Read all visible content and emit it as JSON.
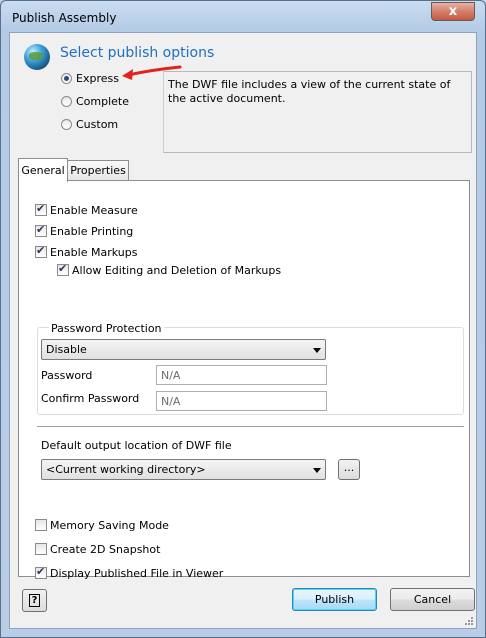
{
  "window": {
    "title": "Publish Assembly",
    "close_glyph": "x"
  },
  "header": {
    "icon": "globe-icon",
    "heading": "Select publish options"
  },
  "publish_mode": {
    "options": [
      {
        "label": "Express",
        "selected": true
      },
      {
        "label": "Complete",
        "selected": false
      },
      {
        "label": "Custom",
        "selected": false
      }
    ],
    "description": "The DWF file includes a view of the current state of the active document."
  },
  "tabs": [
    {
      "label": "General",
      "active": true
    },
    {
      "label": "Properties",
      "active": false
    }
  ],
  "general": {
    "enable_measure": {
      "label": "Enable Measure",
      "checked": true
    },
    "enable_printing": {
      "label": "Enable Printing",
      "checked": true
    },
    "enable_markups": {
      "label": "Enable Markups",
      "checked": true
    },
    "allow_editing": {
      "label": "Allow Editing and Deletion of Markups",
      "checked": true
    },
    "password_protection": {
      "group_label": "Password Protection",
      "mode": "Disable",
      "password_label": "Password",
      "password_value": "N/A",
      "confirm_label": "Confirm Password",
      "confirm_value": "N/A"
    },
    "output": {
      "label": "Default output location of DWF file",
      "location": "<Current working directory>",
      "browse_label": "..."
    },
    "memory_saving": {
      "label": "Memory Saving Mode",
      "checked": false
    },
    "create_snapshot": {
      "label": "Create 2D Snapshot",
      "checked": false
    },
    "display_in_viewer": {
      "label": "Display Published File in Viewer",
      "checked": true
    }
  },
  "footer": {
    "help_glyph": "?",
    "publish_label": "Publish",
    "cancel_label": "Cancel"
  },
  "colors": {
    "heading": "#1f6fc1",
    "annotation_arrow": "#e0231e"
  }
}
